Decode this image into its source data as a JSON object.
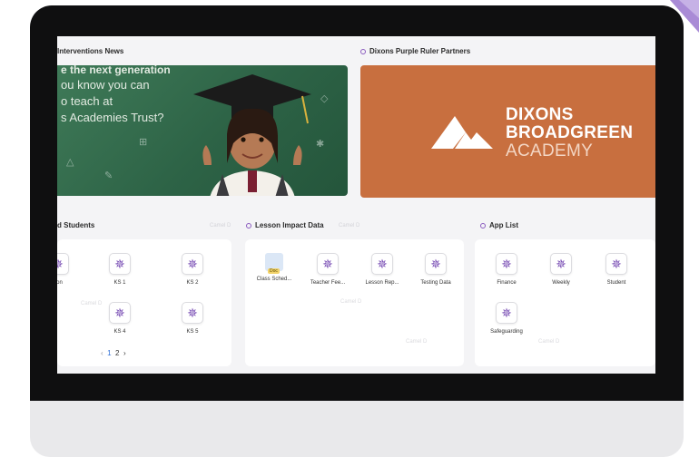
{
  "sections": {
    "news": "Interventions News",
    "partners": "Dixons Purple Ruler Partners",
    "students": "d Students",
    "lesson_impact": "Lesson Impact Data",
    "app_list": "App List"
  },
  "news_banner": {
    "lines": [
      "e the next generation",
      "ou know you can",
      "o teach at",
      "s Academies Trust?"
    ]
  },
  "partner_banner": {
    "lines": [
      "DIXONS",
      "BROADGREEN",
      "ACADEMY"
    ],
    "bg_color": "#c86f3f"
  },
  "students": {
    "tiles": [
      {
        "label": "son"
      },
      {
        "label": "KS 1"
      },
      {
        "label": "KS 2"
      },
      {
        "label": "KS 4"
      },
      {
        "label": "KS 5"
      }
    ],
    "pager": {
      "prev": "‹",
      "page1": "1",
      "page2": "2",
      "next": "›"
    }
  },
  "lesson_impact": {
    "tiles": [
      {
        "label": "Class Sched...",
        "badge": "Doc"
      },
      {
        "label": "Teacher Fee..."
      },
      {
        "label": "Lesson Rep..."
      },
      {
        "label": "Testing Data"
      }
    ]
  },
  "app_list": {
    "tiles": [
      {
        "label": "Finance"
      },
      {
        "label": "Weekly"
      },
      {
        "label": "Student"
      },
      {
        "label": "Safeguarding"
      }
    ]
  },
  "watermark": "Camel D"
}
